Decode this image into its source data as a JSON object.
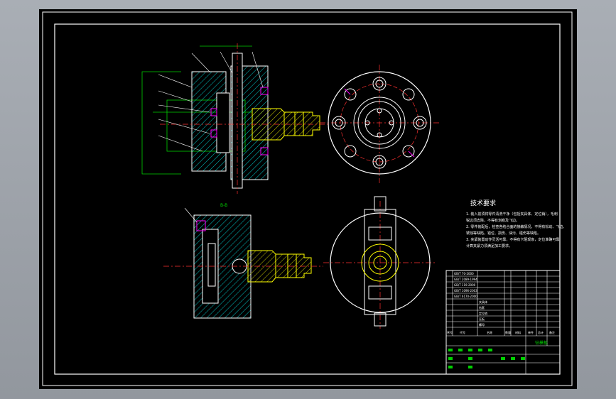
{
  "drawing": {
    "tech_req_title": "技术要求",
    "tech_req_lines": [
      "1. 装入前须将零件清洗干净（包括夹具体、定位销），毛刺",
      "锐边须去除，不得有划痕及飞边。",
      "2. 零件装配后，检查各结合面的接触情况，不得有松动、飞边、",
      "锈蚀等缺陷，错位、损伤、油污、碰伤等缺陷。",
      "3. 夹紧装置动作灵活可靠，不得有卡阻现象，定位准确可靠",
      "计算夹紧力须满足加工要求。"
    ],
    "section_label": "B-B",
    "title_block": {
      "header": [
        "序号",
        "代号",
        "名称",
        "数量",
        "材料",
        "单件",
        "总计",
        "备注"
      ],
      "drawing_name": "钻模板",
      "rows": [
        "GB/T 70-2000",
        "GB/T 2089-1994",
        "GB/T 119-2000",
        "GB/T 1096-2003",
        "GB/T 6170-2000",
        "夹具体",
        "钻套",
        "定位销",
        "压板",
        "螺母"
      ]
    }
  },
  "colors": {
    "line": "#ffffff",
    "hatch": "#00c8c8",
    "dimension": "#00d000",
    "centerline": "#ff3030",
    "yellow_part": "#ffff00",
    "magenta": "#ff00ff",
    "blue": "#3a6cff"
  }
}
